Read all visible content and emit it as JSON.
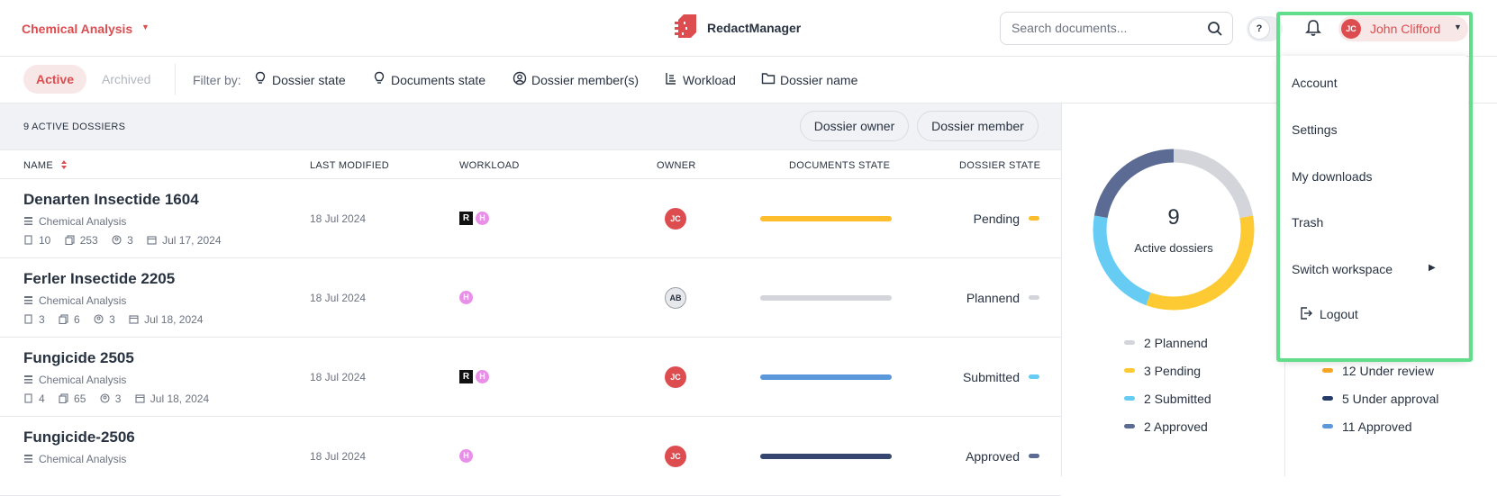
{
  "header": {
    "workspace": "Chemical Analysis",
    "brand": "RedactManager",
    "search_placeholder": "Search documents...",
    "help_icon_glyph": "?",
    "user_initials": "JC",
    "user_name": "John Clifford"
  },
  "filters": {
    "active_label": "Active",
    "archived_label": "Archived",
    "filter_by": "Filter by:",
    "items": [
      "Dossier state",
      "Documents state",
      "Dossier member(s)",
      "Workload",
      "Dossier name"
    ]
  },
  "list": {
    "count_label": "9 ACTIVE DOSSIERS",
    "owner_chip": "Dossier owner",
    "member_chip": "Dossier member",
    "columns": [
      "NAME",
      "LAST MODIFIED",
      "WORKLOAD",
      "OWNER",
      "DOCUMENTS STATE",
      "DOSSIER STATE"
    ],
    "rows": [
      {
        "name": "Denarten Insectide 1604",
        "template": "Chemical Analysis",
        "docs": "10",
        "pages": "253",
        "members": "3",
        "date": "Jul 17, 2024",
        "modified": "18 Jul 2024",
        "workload_r": "R",
        "workload_h": "H",
        "owner": "JC",
        "state": "Pending",
        "bar_color": "#fdbd2c",
        "dot_color": "#fdbd2c"
      },
      {
        "name": "Ferler Insectide 2205",
        "template": "Chemical Analysis",
        "docs": "3",
        "pages": "6",
        "members": "3",
        "date": "Jul 18, 2024",
        "modified": "18 Jul 2024",
        "workload_r": "",
        "workload_h": "H",
        "owner": "AB",
        "state": "Plannend",
        "bar_color": "#d3d5da",
        "dot_color": "#d3d5da"
      },
      {
        "name": "Fungicide 2505",
        "template": "Chemical Analysis",
        "docs": "4",
        "pages": "65",
        "members": "3",
        "date": "Jul 18, 2024",
        "modified": "18 Jul 2024",
        "workload_r": "R",
        "workload_h": "H",
        "owner": "JC",
        "state": "Submitted",
        "bar_color": "#5b97db",
        "dot_color": "#66ccf4"
      },
      {
        "name": "Fungicide-2506",
        "template": "Chemical Analysis",
        "docs": "",
        "pages": "",
        "members": "",
        "date": "",
        "modified": "18 Jul 2024",
        "workload_r": "",
        "workload_h": "H",
        "owner": "JC",
        "state": "Approved",
        "bar_color": "#354771",
        "dot_color": "#5b6b93"
      }
    ]
  },
  "stats": {
    "total": "9",
    "total_label": "Active dossiers",
    "legend_left": [
      {
        "label": "2 Plannend",
        "color": "#d3d5da"
      },
      {
        "label": "3 Pending",
        "color": "#fdca33"
      },
      {
        "label": "2 Submitted",
        "color": "#66ccf4"
      },
      {
        "label": "2 Approved",
        "color": "#5b6b93"
      }
    ],
    "legend_right": [
      {
        "label": "12 Under review",
        "color": "#f5a623"
      },
      {
        "label": "5 Under approval",
        "color": "#283c6b"
      },
      {
        "label": "11 Approved",
        "color": "#5b97db"
      }
    ]
  },
  "user_menu": {
    "items": [
      "Account",
      "Settings",
      "My downloads",
      "Trash",
      "Switch workspace",
      "Logout"
    ]
  },
  "colors": {
    "accent": "#dd4d50",
    "highlight": "#62dd8c"
  }
}
